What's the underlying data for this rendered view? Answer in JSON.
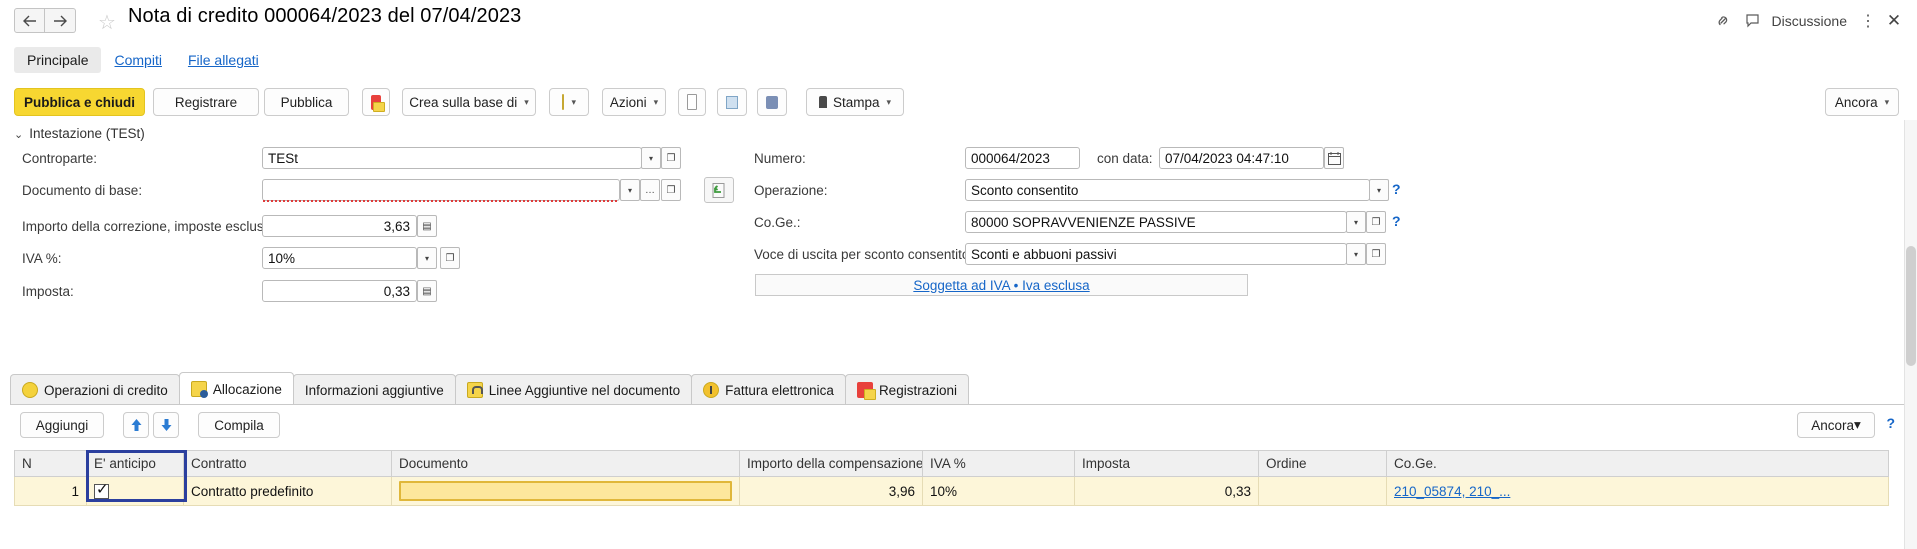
{
  "titlebar": {
    "back_icon": "arrow-left-icon",
    "forward_icon": "arrow-right-icon",
    "favorite_icon": "star-icon",
    "title": "Nota di credito 000064/2023 del 07/04/2023",
    "link_icon": "link-icon",
    "discussion_icon": "speech-bubble-icon",
    "discussion_label": "Discussione",
    "more_icon": "kebab-menu-icon",
    "close_icon": "close-icon"
  },
  "page_tabs": [
    {
      "label": "Principale",
      "active": true
    },
    {
      "label": "Compiti",
      "active": false
    },
    {
      "label": "File allegati",
      "active": false
    }
  ],
  "toolbar": {
    "publish_and_close": "Pubblica e chiudi",
    "register": "Registrare",
    "publish": "Pubblica",
    "red_list_icon": "red-list-icon",
    "create_based_on": "Crea sulla base di",
    "doc_yellow_icon": "yellow-document-icon",
    "actions": "Azioni",
    "report_icon": "document-report-icon",
    "table_icon": "table-grid-icon",
    "cubes_icon": "cubes-icon",
    "print_icon": "printer-icon",
    "print": "Stampa",
    "more": "Ancora",
    "caret": "▾"
  },
  "header_section": {
    "toggle_label": "Intestazione (TESt)",
    "chevron": "⌄"
  },
  "form_left": {
    "counterparty_label": "Controparte:",
    "counterparty_value": "TESt",
    "base_document_label": "Documento di base:",
    "base_document_value": "",
    "correction_amount_label": "Importo della correzione, imposte escluse:",
    "correction_amount_value": "3,63",
    "vat_percent_label": "IVA %:",
    "vat_percent_value": "10%",
    "tax_label": "Imposta:",
    "tax_value": "0,33"
  },
  "form_right": {
    "number_label": "Numero:",
    "number_value": "000064/2023",
    "date_label": "con data:",
    "date_value": "07/04/2023 04:47:10",
    "calendar_icon": "calendar-icon",
    "operation_label": "Operazione:",
    "operation_value": "Sconto consentito",
    "coge_label": "Co.Ge.:",
    "coge_value": "80000 SOPRAVVENIENZE PASSIVE",
    "expense_item_label": "Voce di uscita per sconto consentito:",
    "expense_item_value": "Sconti e abbuoni passivi",
    "vat_banner_link": "Soggetta ad IVA • Iva esclusa",
    "help_icon": "question-mark-icon",
    "restore_icon": "restore-green-icon"
  },
  "bottom_tabs": [
    {
      "label": "Operazioni di credito",
      "icon": "coins-icon",
      "active": false
    },
    {
      "label": "Allocazione",
      "icon": "allocation-icon",
      "active": true
    },
    {
      "label": "Informazioni aggiuntive",
      "icon": "",
      "active": false
    },
    {
      "label": "Linee Aggiuntive nel documento",
      "icon": "lock-icon",
      "active": false
    },
    {
      "label": "Fattura elettronica",
      "icon": "electronic-invoice-icon",
      "active": false
    },
    {
      "label": "Registrazioni",
      "icon": "registrations-icon",
      "active": false
    }
  ],
  "grid_toolbar": {
    "add": "Aggiungi",
    "move_up_icon": "arrow-up-icon",
    "move_down_icon": "arrow-down-icon",
    "fill": "Compila",
    "more": "Ancora",
    "caret": "▾",
    "help_icon": "question-mark-icon"
  },
  "table": {
    "columns": [
      "N",
      "E' anticipo",
      "Contratto",
      "Documento",
      "Importo della compensazione",
      "IVA %",
      "Imposta",
      "Ordine",
      "Co.Ge."
    ],
    "rows": [
      {
        "n": "1",
        "is_advance": true,
        "contract": "Contratto predefinito",
        "document": "",
        "compensation_amount": "3,96",
        "vat_percent": "10%",
        "tax": "0,33",
        "order": "",
        "coge": "210_05874, 210_..."
      }
    ]
  },
  "colors": {
    "primary_button": "#f7d731",
    "link": "#1666c8",
    "row_background": "#fdf6d9",
    "highlight_cell": "#fde79c",
    "selection_box": "#2b3f9e"
  }
}
